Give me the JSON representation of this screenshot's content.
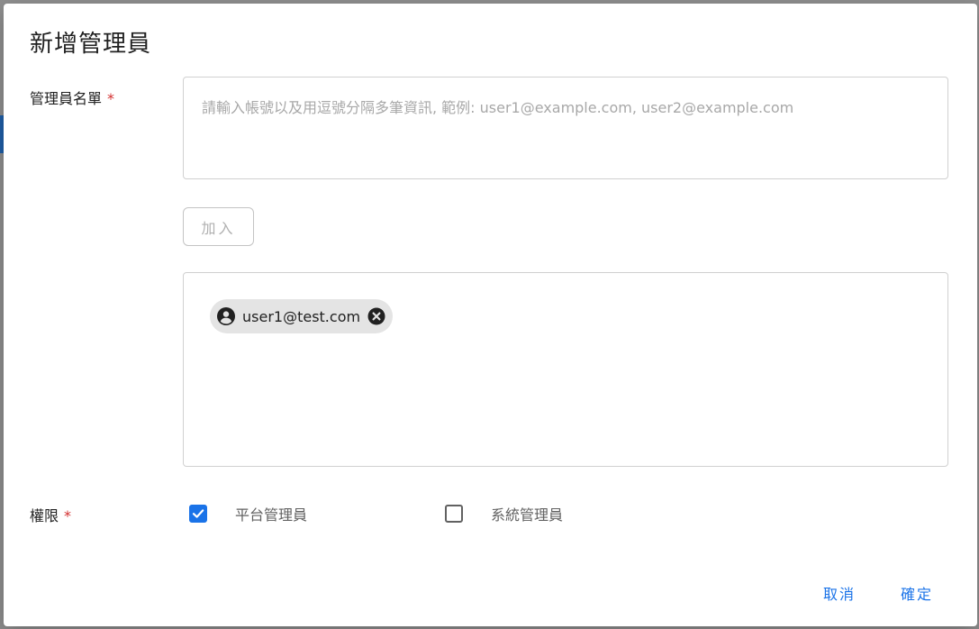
{
  "dialog": {
    "title": "新增管理員"
  },
  "admin_list": {
    "label": "管理員名單",
    "required_mark": "*",
    "placeholder": "請輸入帳號以及用逗號分隔多筆資訊, 範例: user1@example.com, user2@example.com",
    "value": "",
    "add_button_label": "加入",
    "chips": [
      {
        "text": "user1@test.com",
        "icon": "account-circle-icon",
        "remove_icon": "remove-circle-icon"
      }
    ]
  },
  "permissions": {
    "label": "權限",
    "required_mark": "*",
    "options": [
      {
        "label": "平台管理員",
        "checked": true
      },
      {
        "label": "系統管理員",
        "checked": false
      }
    ]
  },
  "footer": {
    "cancel_label": "取消",
    "confirm_label": "確定"
  },
  "colors": {
    "accent": "#1a73e8",
    "required": "#d32f2f",
    "chip_bg": "#e4e4e4"
  }
}
